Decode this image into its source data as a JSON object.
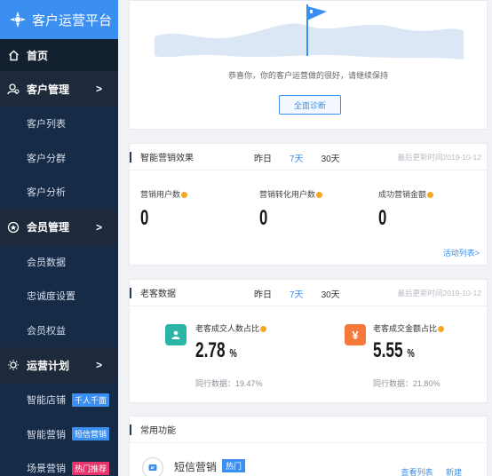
{
  "app": {
    "title": "客户运营平台"
  },
  "sidebar": {
    "home": "首页",
    "groups": [
      {
        "label": "客户管理",
        "items": [
          {
            "label": "客户列表"
          },
          {
            "label": "客户分群"
          },
          {
            "label": "客户分析"
          }
        ]
      },
      {
        "label": "会员管理",
        "items": [
          {
            "label": "会员数据"
          },
          {
            "label": "忠诚度设置"
          },
          {
            "label": "会员权益"
          }
        ]
      },
      {
        "label": "运营计划",
        "items": [
          {
            "label": "智能店铺",
            "badge": "千人千面",
            "badge_color": "#3b8ff0"
          },
          {
            "label": "智能营销",
            "badge": "短信营销",
            "badge_color": "#3b8ff0"
          },
          {
            "label": "场景营销",
            "badge": "热门推荐",
            "badge_color": "#e8336b"
          }
        ]
      }
    ]
  },
  "hero": {
    "message": "恭喜你，你的客户运营做的很好，请继续保持",
    "button": "全面诊断"
  },
  "marketing": {
    "title": "智能营销效果",
    "tabs": [
      "昨日",
      "7天",
      "30天"
    ],
    "active_tab": "7天",
    "updated": "最后更新时间2019-10-12",
    "metrics": [
      {
        "label": "营销用户数",
        "value": "0"
      },
      {
        "label": "营销转化用户数",
        "value": "0"
      },
      {
        "label": "成功营销金额",
        "value": "0"
      }
    ],
    "link": "活动列表>"
  },
  "old_customers": {
    "title": "老客数据",
    "tabs": [
      "昨日",
      "7天",
      "30天"
    ],
    "active_tab": "7天",
    "updated": "最后更新时间2019-10-12",
    "metrics": [
      {
        "label": "老客成交人数占比",
        "value": "2.78",
        "unit": "%",
        "peer": "同行数据：19.47%",
        "icon_color": "#2bb5a6"
      },
      {
        "label": "老客成交金额占比",
        "value": "5.55",
        "unit": "%",
        "peer": "同行数据：21.80%",
        "icon_color": "#f5793b"
      }
    ]
  },
  "common": {
    "title": "常用功能",
    "items": [
      {
        "name": "短信营销",
        "tag": "热门",
        "links": [
          "查看列表",
          "新建"
        ]
      }
    ]
  }
}
